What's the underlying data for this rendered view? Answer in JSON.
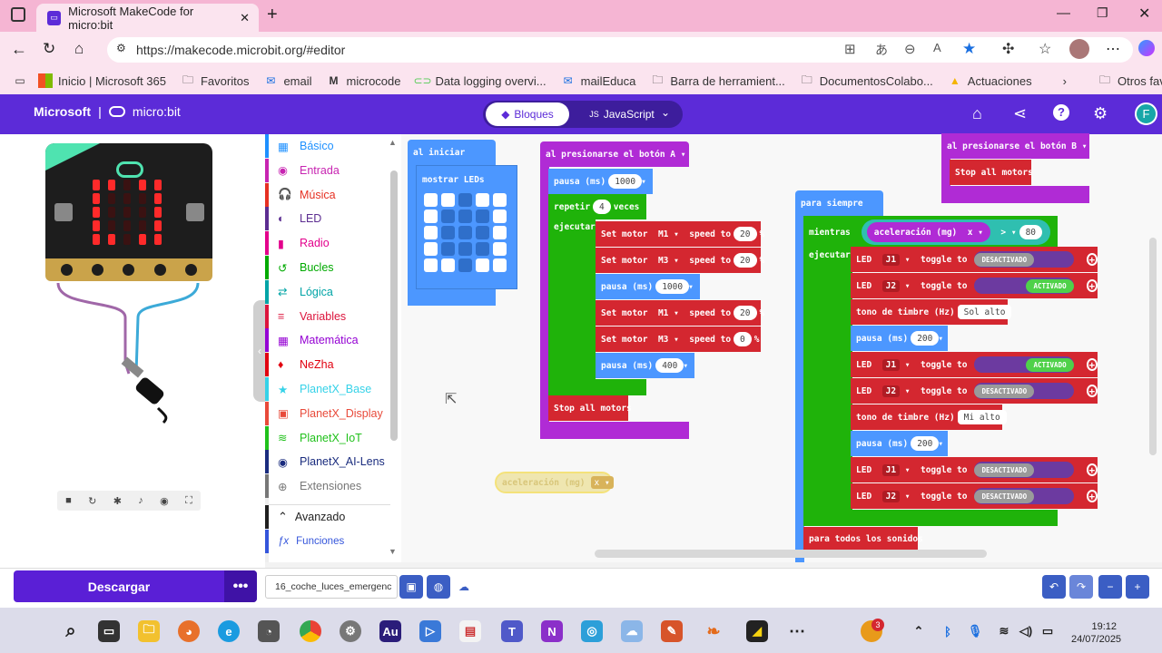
{
  "browser": {
    "tab_title": "Microsoft MakeCode for micro:bit",
    "url": "https://makecode.microbit.org/#editor",
    "favorites": [
      "Inicio | Microsoft 365",
      "Favoritos",
      "email",
      "microcode",
      "Data logging overvi...",
      "mailEduca",
      "Barra de herramient...",
      "DocumentosColabo...",
      "Actuaciones"
    ],
    "other_favorites": "Otros favoritos"
  },
  "header": {
    "brand_microsoft": "Microsoft",
    "brand_microbit": "micro:bit",
    "tab_blocks": "Bloques",
    "tab_js": "JavaScript",
    "avatar_initial": "F"
  },
  "toolbox": {
    "categories": [
      {
        "label": "Básico",
        "color": "#1e90ff"
      },
      {
        "label": "Entrada",
        "color": "#c724b1"
      },
      {
        "label": "Música",
        "color": "#e63022"
      },
      {
        "label": "LED",
        "color": "#5c2d91"
      },
      {
        "label": "Radio",
        "color": "#e3008c"
      },
      {
        "label": "Bucles",
        "color": "#00aa00"
      },
      {
        "label": "Lógica",
        "color": "#00a4a6"
      },
      {
        "label": "Variables",
        "color": "#dc143c"
      },
      {
        "label": "Matemática",
        "color": "#9400d3"
      },
      {
        "label": "NeZha",
        "color": "#e1000f"
      },
      {
        "label": "PlanetX_Base",
        "color": "#35d2e8"
      },
      {
        "label": "PlanetX_Display",
        "color": "#e84a3a"
      },
      {
        "label": "PlanetX_IoT",
        "color": "#20c11b"
      },
      {
        "label": "PlanetX_AI-Lens",
        "color": "#1a2c7e"
      },
      {
        "label": "Extensiones",
        "color": "#777777"
      }
    ],
    "advanced": "Avanzado",
    "functions": "Funciones"
  },
  "blocks": {
    "on_start": "al iniciar",
    "show_leds": "mostrar LEDs",
    "on_button_a": "al presionarse el botón",
    "button_a": "A",
    "pause": "pausa (ms)",
    "v1000": "1000",
    "repeat": "repetir",
    "v4": "4",
    "times": "veces",
    "do": "ejecutar",
    "set_motor": "Set motor",
    "m1": "M1",
    "m3": "M3",
    "speed_to": "speed to",
    "v20": "20",
    "v0": "0",
    "v400": "400",
    "pct": "%",
    "stop_all": "Stop all motors",
    "accel_floating": "aceleración (mg)",
    "x": "x",
    "on_button_b": "al presionarse el botón",
    "button_b": "B",
    "forever": "para siempre",
    "while": "mientras",
    "accel": "aceleración (mg)",
    "gt": ">",
    "v80": "80",
    "led": "LED",
    "j1": "J1",
    "j2": "J2",
    "toggle_to": "toggle to",
    "off": "DESACTIVADO",
    "on": "ACTIVADO",
    "tone": "tono de timbre (Hz)",
    "sol_alto": "Sol alto",
    "mi_alto": "Mi alto",
    "v200": "200",
    "all_sounds": "para todos los sonidos"
  },
  "footer": {
    "download": "Descargar",
    "project_name": "16_coche_luces_emergenc"
  },
  "taskbar": {
    "time": "19:12",
    "date": "24/07/2025",
    "badge": "3"
  }
}
